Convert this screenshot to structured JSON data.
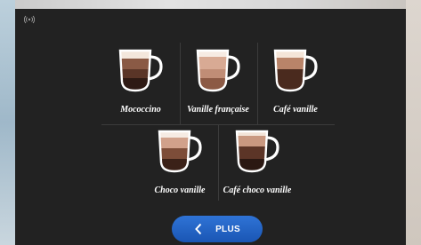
{
  "screen": {
    "status_icon": "wifi-icon"
  },
  "drinks_row1": [
    {
      "label": "Mococcino",
      "icon": "mococcino-cup-icon"
    },
    {
      "label": "Vanille française",
      "icon": "vanille-francaise-cup-icon"
    },
    {
      "label": "Café vanille",
      "icon": "cafe-vanille-cup-icon"
    }
  ],
  "drinks_row2": [
    {
      "label": "Choco vanille",
      "icon": "choco-vanille-cup-icon"
    },
    {
      "label": "Café choco vanille",
      "icon": "cafe-choco-vanille-cup-icon"
    }
  ],
  "footer": {
    "more_button_label": "PLUS",
    "more_button_icon": "chevron-left-icon"
  },
  "colors": {
    "screen_bg": "#222222",
    "accent": "#2366c8",
    "text": "#ffffff"
  }
}
